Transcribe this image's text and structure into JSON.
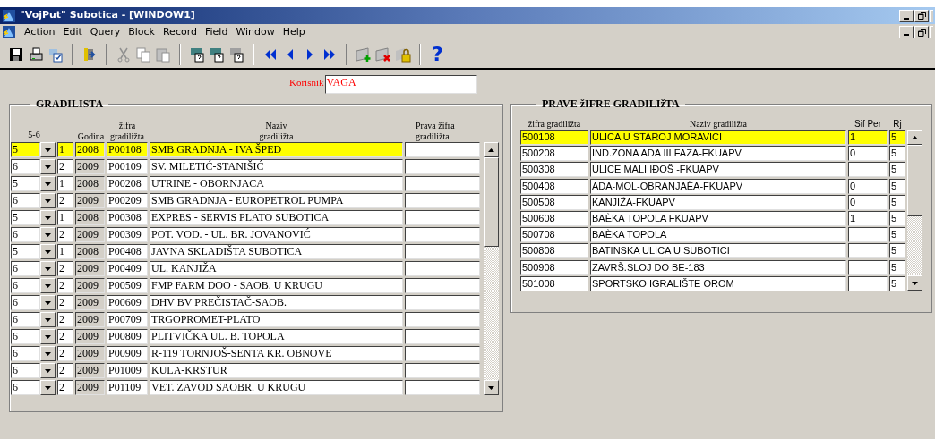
{
  "window": {
    "title": "\"VojPut\" Subotica - [WINDOW1]"
  },
  "menu": [
    "Action",
    "Edit",
    "Query",
    "Block",
    "Record",
    "Field",
    "Window",
    "Help"
  ],
  "toolbar": {
    "help": "?"
  },
  "user": {
    "label": "Korisnik",
    "value": "VAGA"
  },
  "left": {
    "title": "GRADILISTA",
    "columns": [
      "5-6",
      "Godina",
      "žifra gradiližta",
      "Naziv gradiližta",
      "Prava žifra gradiližta"
    ],
    "rows": [
      {
        "type": "5",
        "rj": "1",
        "year": "2008",
        "code": "P00108",
        "name": "SMB GRADNJA - IVA ŠPED",
        "selected": true
      },
      {
        "type": "6",
        "rj": "2",
        "year": "2009",
        "code": "P00109",
        "name": "SV. MILETIĆ-STANIŠIĆ",
        "selected": false
      },
      {
        "type": "5",
        "rj": "1",
        "year": "2008",
        "code": "P00208",
        "name": "UTRINE - OBORNJACA",
        "selected": false
      },
      {
        "type": "6",
        "rj": "2",
        "year": "2009",
        "code": "P00209",
        "name": "SMB GRADNJA - EUROPETROL PUMPA",
        "selected": false
      },
      {
        "type": "5",
        "rj": "1",
        "year": "2008",
        "code": "P00308",
        "name": "EXPRES - SERVIS PLATO SUBOTICA",
        "selected": false
      },
      {
        "type": "6",
        "rj": "2",
        "year": "2009",
        "code": "P00309",
        "name": "POT. VOD. -  UL. BR. JOVANOVIĆ",
        "selected": false
      },
      {
        "type": "5",
        "rj": "1",
        "year": "2008",
        "code": "P00408",
        "name": "JAVNA SKLADIŠTA SUBOTICA",
        "selected": false
      },
      {
        "type": "6",
        "rj": "2",
        "year": "2009",
        "code": "P00409",
        "name": "UL. KANJIŽA",
        "selected": false
      },
      {
        "type": "6",
        "rj": "2",
        "year": "2009",
        "code": "P00509",
        "name": "FMP FARM DOO - SAOB. U KRUGU",
        "selected": false
      },
      {
        "type": "6",
        "rj": "2",
        "year": "2009",
        "code": "P00609",
        "name": "DHV BV  PREČISTAČ-SAOB.",
        "selected": false
      },
      {
        "type": "6",
        "rj": "2",
        "year": "2009",
        "code": "P00709",
        "name": "TRGOPROMET-PLATO",
        "selected": false
      },
      {
        "type": "6",
        "rj": "2",
        "year": "2009",
        "code": "P00809",
        "name": "PLITVIČKA UL. B. TOPOLA",
        "selected": false
      },
      {
        "type": "6",
        "rj": "2",
        "year": "2009",
        "code": "P00909",
        "name": "R-119 TORNJOŠ-SENTA KR. OBNOVE",
        "selected": false
      },
      {
        "type": "6",
        "rj": "2",
        "year": "2009",
        "code": "P01009",
        "name": "KULA-KRSTUR",
        "selected": false
      },
      {
        "type": "6",
        "rj": "2",
        "year": "2009",
        "code": "P01109",
        "name": "VET. ZAVOD SAOBR. U KRUGU",
        "selected": false
      }
    ]
  },
  "right": {
    "title": "PRAVE žIFRE GRADILIžTA",
    "columns": [
      "žifra gradiližta",
      "Naziv gradiližta",
      "Sif Per",
      "Rj"
    ],
    "rows": [
      {
        "code": "500108",
        "name": "ULICA U STAROJ MORAVICI",
        "per": "1",
        "rj": "5",
        "selected": true
      },
      {
        "code": "500208",
        "name": "IND.ZONA ADA III FAZA-FKUAPV",
        "per": "0",
        "rj": "5",
        "selected": false
      },
      {
        "code": "500308",
        "name": "ULICE MALI IĐOŠ -FKUAPV",
        "rj": "5",
        "selected": false
      },
      {
        "code": "500408",
        "name": "ADA-MOL-OBRANJAÈA-FKUAPV",
        "per": "0",
        "rj": "5",
        "selected": false
      },
      {
        "code": "500508",
        "name": "KANJIŽA-FKUAPV",
        "per": "0",
        "rj": "5",
        "selected": false
      },
      {
        "code": "500608",
        "name": "BAÈKA TOPOLA FKUAPV",
        "per": "1",
        "rj": "5",
        "selected": false
      },
      {
        "code": "500708",
        "name": "BAÈKA TOPOLA",
        "rj": "5",
        "selected": false
      },
      {
        "code": "500808",
        "name": "BATINSKA ULICA U SUBOTICI",
        "rj": "5",
        "selected": false
      },
      {
        "code": "500908",
        "name": "ZAVRŠ.SLOJ DO BE-183",
        "rj": "5",
        "selected": false
      },
      {
        "code": "501008",
        "name": "SPORTSKO IGRALIŠTE OROM",
        "rj": "5",
        "selected": false
      }
    ]
  }
}
